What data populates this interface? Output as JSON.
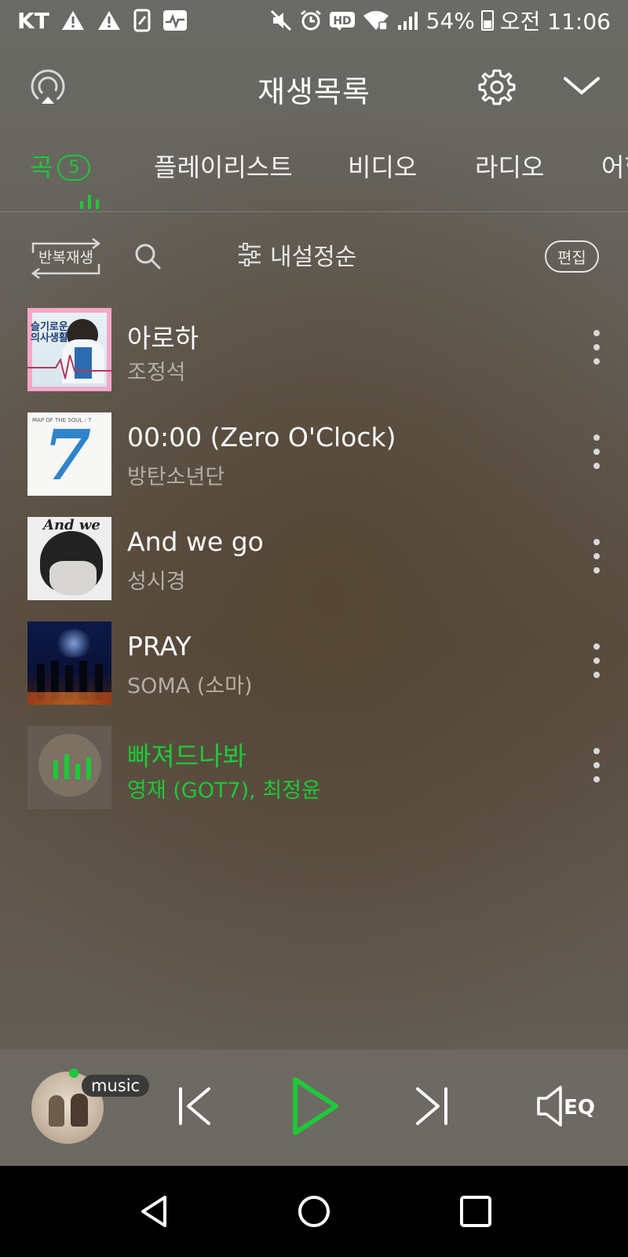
{
  "status_bar": {
    "carrier": "KT",
    "battery": "54%",
    "time": "오전 11:06",
    "hd_label": "HD"
  },
  "header": {
    "title": "재생목록"
  },
  "tabs": [
    {
      "label": "곡",
      "count": "5",
      "active": true
    },
    {
      "label": "플레이리스트"
    },
    {
      "label": "비디오"
    },
    {
      "label": "라디오"
    },
    {
      "label": "어학"
    }
  ],
  "toolbar": {
    "repeat_label": "반복재생",
    "sort_label": "내설정순",
    "edit_label": "편집"
  },
  "songs": [
    {
      "title": "아로하",
      "artist": "조정석"
    },
    {
      "title": "00:00 (Zero O'Clock)",
      "artist": "방탄소년단"
    },
    {
      "title": "And we go",
      "artist": "성시경"
    },
    {
      "title": "PRAY",
      "artist": "SOMA (소마)"
    },
    {
      "title": "빠져드나봐",
      "artist": "영재 (GOT7), 최정윤",
      "playing": true
    }
  ],
  "album_art_text": {
    "art1": "슬기로운 의사생활",
    "art2_top": "MAP OF THE SOUL : 7",
    "art2_num": "7",
    "art3": "And we"
  },
  "player": {
    "badge": "music",
    "eq_label": "EQ"
  },
  "colors": {
    "accent": "#1ec83a",
    "nav_bg": "#000000"
  }
}
